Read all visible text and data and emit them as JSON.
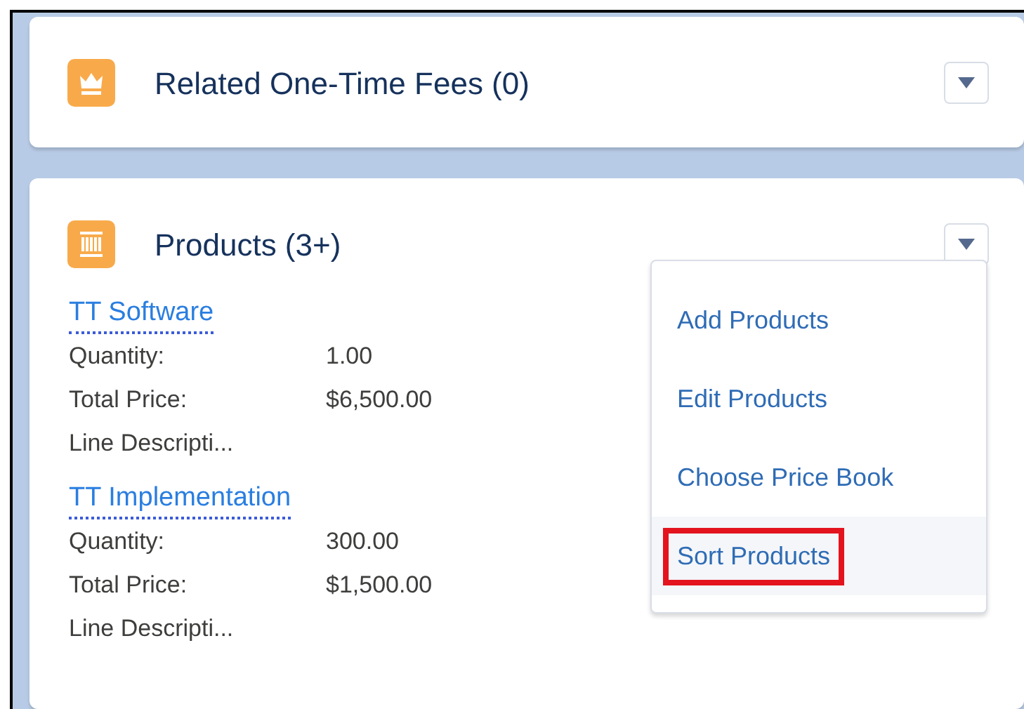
{
  "cards": [
    {
      "kind": "fees",
      "title": "Related One-Time Fees (0)"
    },
    {
      "kind": "products",
      "title": "Products (3+)",
      "items": [
        {
          "name": "TT Software",
          "fields": [
            {
              "label": "Quantity:",
              "value": "1.00"
            },
            {
              "label": "Total Price:",
              "value": "$6,500.00"
            },
            {
              "label": "Line Descripti..."
            }
          ]
        },
        {
          "name": "TT Implementation",
          "fields": [
            {
              "label": "Quantity:",
              "value": "300.00"
            },
            {
              "label": "Total Price:",
              "value": "$1,500.00"
            },
            {
              "label": "Line Descripti..."
            }
          ]
        }
      ],
      "menu": [
        {
          "label": "Add Products",
          "selected": false
        },
        {
          "label": "Edit Products",
          "selected": false
        },
        {
          "label": "Choose Price Book",
          "selected": false
        },
        {
          "label": "Sort Products",
          "selected": true
        }
      ]
    }
  ]
}
